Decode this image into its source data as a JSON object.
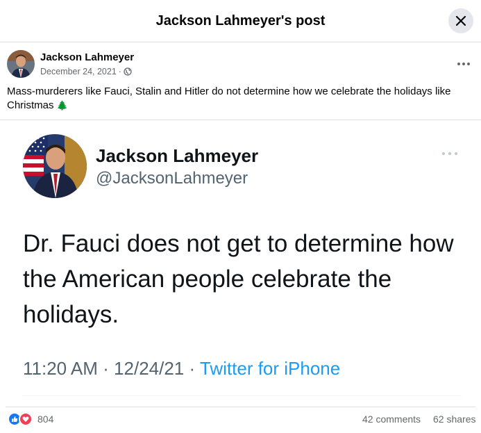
{
  "dialog": {
    "title": "Jackson Lahmeyer's post"
  },
  "post": {
    "author": "Jackson Lahmeyer",
    "date": "December 24, 2021",
    "date_separator": "·",
    "privacy_icon": "globe-icon",
    "text": "Mass-murderers like Fauci, Stalin and Hitler do not determine how we celebrate the holidays like Christmas",
    "text_emoji": "🌲"
  },
  "tweet": {
    "name": "Jackson Lahmeyer",
    "handle": "@JacksonLahmeyer",
    "body": "Dr. Fauci does not get to determine how the American people celebrate the holidays.",
    "time": "11:20 AM",
    "date": "12/24/21",
    "separator": " · ",
    "source": "Twitter for iPhone"
  },
  "reactions": {
    "icons": [
      "like-icon",
      "love-icon"
    ],
    "count": "804",
    "comments": "42 comments",
    "shares": "62 shares"
  },
  "colors": {
    "facebook_blue": "#1877f2",
    "love_red": "#f33e58",
    "twitter_blue": "#1d9bf0",
    "meta_gray": "#65676b"
  }
}
